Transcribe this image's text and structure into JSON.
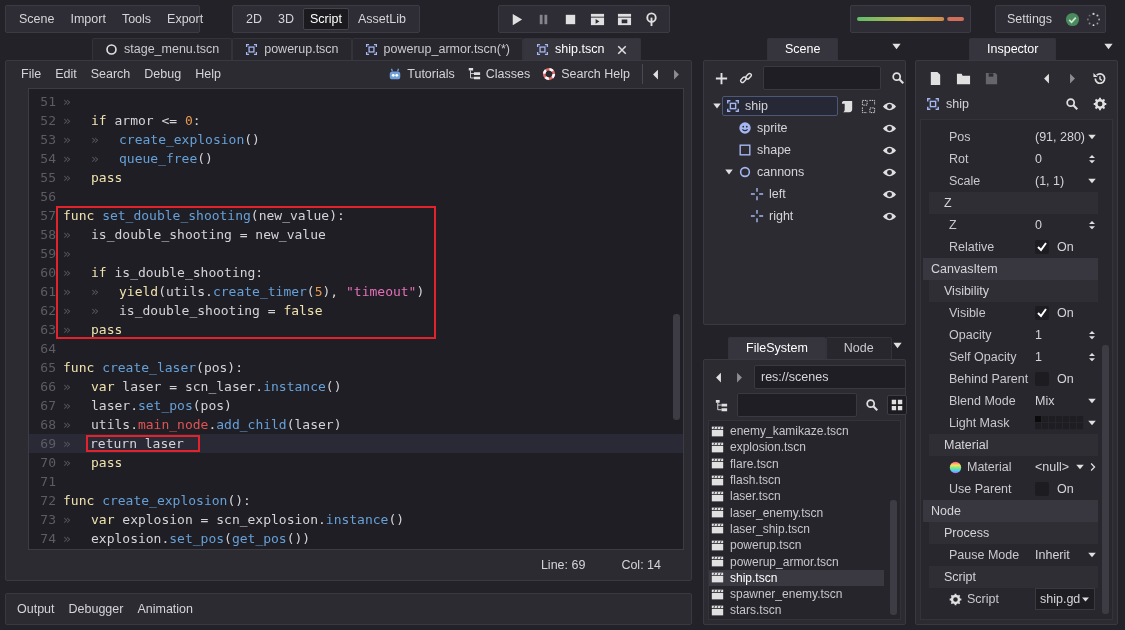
{
  "menus": [
    "Scene",
    "Import",
    "Tools",
    "Export"
  ],
  "workspaces": [
    {
      "label": "2D",
      "selected": false
    },
    {
      "label": "3D",
      "selected": false
    },
    {
      "label": "Script",
      "selected": true
    },
    {
      "label": "AssetLib",
      "selected": false
    }
  ],
  "settings": {
    "label": "Settings"
  },
  "scene_tabs": [
    {
      "label": "stage_menu.tscn",
      "kind": "node",
      "selected": false
    },
    {
      "label": "powerup.tscn",
      "kind": "node2d",
      "selected": false
    },
    {
      "label": "powerup_armor.tscn(*)",
      "kind": "node2d",
      "selected": false
    },
    {
      "label": "ship.tscn",
      "kind": "node2d",
      "selected": true
    }
  ],
  "script_menu": [
    "File",
    "Edit",
    "Search",
    "Debug",
    "Help"
  ],
  "help_buttons": [
    {
      "label": "Tutorials",
      "kind": "tutorials"
    },
    {
      "label": "Classes",
      "kind": "classes"
    },
    {
      "label": "Search Help",
      "kind": "search_help"
    }
  ],
  "code": {
    "lines": [
      {
        "number": "51",
        "boxed": false,
        "current": false,
        "tokens": [
          {
            "text": "»",
            "kind": "tab"
          }
        ]
      },
      {
        "number": "52",
        "boxed": false,
        "current": false,
        "tokens": [
          {
            "text": "»",
            "kind": "tab"
          },
          {
            "text": "if",
            "kind": "kw"
          },
          {
            "text": " armor <= ",
            "kind": "plain"
          },
          {
            "text": "0",
            "kind": "num"
          },
          {
            "text": ":",
            "kind": "plain"
          }
        ]
      },
      {
        "number": "53",
        "boxed": false,
        "current": false,
        "tokens": [
          {
            "text": "»",
            "kind": "tab"
          },
          {
            "text": "»",
            "kind": "tab"
          },
          {
            "text": "create_explosion",
            "kind": "fn"
          },
          {
            "text": "()",
            "kind": "plain"
          }
        ]
      },
      {
        "number": "54",
        "boxed": false,
        "current": false,
        "tokens": [
          {
            "text": "»",
            "kind": "tab"
          },
          {
            "text": "»",
            "kind": "tab"
          },
          {
            "text": "queue_free",
            "kind": "fn"
          },
          {
            "text": "()",
            "kind": "plain"
          }
        ]
      },
      {
        "number": "55",
        "boxed": false,
        "current": false,
        "tokens": [
          {
            "text": "»",
            "kind": "tab"
          },
          {
            "text": "pass",
            "kind": "kw"
          }
        ]
      },
      {
        "number": "56",
        "boxed": false,
        "current": false
      },
      {
        "number": "57",
        "boxed": true,
        "current": false,
        "tokens": [
          {
            "text": "func",
            "kind": "kw"
          },
          {
            "text": " set_double_shooting",
            "kind": "fn"
          },
          {
            "text": "(new_value):",
            "kind": "plain"
          }
        ]
      },
      {
        "number": "58",
        "boxed": true,
        "current": false,
        "tokens": [
          {
            "text": "»",
            "kind": "tab"
          },
          {
            "text": "is_double_shooting = new_value",
            "kind": "plain"
          }
        ]
      },
      {
        "number": "59",
        "boxed": true,
        "current": false,
        "tokens": [
          {
            "text": "»",
            "kind": "tab"
          }
        ]
      },
      {
        "number": "60",
        "boxed": true,
        "current": false,
        "tokens": [
          {
            "text": "»",
            "kind": "tab"
          },
          {
            "text": "if",
            "kind": "kw"
          },
          {
            "text": " is_double_shooting:",
            "kind": "plain"
          }
        ]
      },
      {
        "number": "61",
        "boxed": true,
        "current": false,
        "tokens": [
          {
            "text": "»",
            "kind": "tab"
          },
          {
            "text": "»",
            "kind": "tab"
          },
          {
            "text": "yield",
            "kind": "kw"
          },
          {
            "text": "(utils.",
            "kind": "plain"
          },
          {
            "text": "create_timer",
            "kind": "fn"
          },
          {
            "text": "(",
            "kind": "plain"
          },
          {
            "text": "5",
            "kind": "num"
          },
          {
            "text": "), ",
            "kind": "plain"
          },
          {
            "text": "\"timeout\"",
            "kind": "str"
          },
          {
            "text": ")",
            "kind": "plain"
          }
        ]
      },
      {
        "number": "62",
        "boxed": true,
        "current": false,
        "tokens": [
          {
            "text": "»",
            "kind": "tab"
          },
          {
            "text": "»",
            "kind": "tab"
          },
          {
            "text": "is_double_shooting = ",
            "kind": "plain"
          },
          {
            "text": "false",
            "kind": "kw"
          }
        ]
      },
      {
        "number": "63",
        "boxed": true,
        "current": false,
        "tokens": [
          {
            "text": "»",
            "kind": "tab"
          },
          {
            "text": "pass",
            "kind": "kw"
          }
        ]
      },
      {
        "number": "64",
        "boxed": false,
        "current": false
      },
      {
        "number": "65",
        "boxed": false,
        "current": false,
        "tokens": [
          {
            "text": "func",
            "kind": "kw"
          },
          {
            "text": " create_laser",
            "kind": "fn"
          },
          {
            "text": "(pos):",
            "kind": "plain"
          }
        ]
      },
      {
        "number": "66",
        "boxed": false,
        "current": false,
        "tokens": [
          {
            "text": "»",
            "kind": "tab"
          },
          {
            "text": "var",
            "kind": "kw"
          },
          {
            "text": " laser = scn_laser.",
            "kind": "plain"
          },
          {
            "text": "instance",
            "kind": "fn"
          },
          {
            "text": "()",
            "kind": "plain"
          }
        ]
      },
      {
        "number": "67",
        "boxed": false,
        "current": false,
        "tokens": [
          {
            "text": "»",
            "kind": "tab"
          },
          {
            "text": "laser.",
            "kind": "plain"
          },
          {
            "text": "set_pos",
            "kind": "fn"
          },
          {
            "text": "(pos)",
            "kind": "plain"
          }
        ]
      },
      {
        "number": "68",
        "boxed": false,
        "current": false,
        "tokens": [
          {
            "text": "»",
            "kind": "tab"
          },
          {
            "text": "utils.",
            "kind": "plain"
          },
          {
            "text": "main_node",
            "kind": "member"
          },
          {
            "text": ".",
            "kind": "plain"
          },
          {
            "text": "add_child",
            "kind": "fn"
          },
          {
            "text": "(laser)",
            "kind": "plain"
          }
        ]
      },
      {
        "number": "69",
        "boxed": false,
        "current": true,
        "tokens": [
          {
            "text": "»",
            "kind": "tab"
          },
          {
            "text": "return laser",
            "kind": "boxed"
          }
        ]
      },
      {
        "number": "70",
        "boxed": false,
        "current": false,
        "tokens": [
          {
            "text": "»",
            "kind": "tab"
          },
          {
            "text": "pass",
            "kind": "kw"
          }
        ]
      },
      {
        "number": "71",
        "boxed": false,
        "current": false
      },
      {
        "number": "72",
        "boxed": false,
        "current": false,
        "tokens": [
          {
            "text": "func",
            "kind": "kw"
          },
          {
            "text": " create_explosion",
            "kind": "fn"
          },
          {
            "text": "():",
            "kind": "plain"
          }
        ]
      },
      {
        "number": "73",
        "boxed": false,
        "current": false,
        "tokens": [
          {
            "text": "»",
            "kind": "tab"
          },
          {
            "text": "var",
            "kind": "kw"
          },
          {
            "text": " explosion = scn_explosion.",
            "kind": "plain"
          },
          {
            "text": "instance",
            "kind": "fn"
          },
          {
            "text": "()",
            "kind": "plain"
          }
        ]
      },
      {
        "number": "74",
        "boxed": false,
        "current": false,
        "tokens": [
          {
            "text": "»",
            "kind": "tab"
          },
          {
            "text": "explosion.",
            "kind": "plain"
          },
          {
            "text": "set_pos",
            "kind": "fn"
          },
          {
            "text": "(",
            "kind": "plain"
          },
          {
            "text": "get_pos",
            "kind": "fn"
          },
          {
            "text": "())",
            "kind": "plain"
          }
        ]
      }
    ]
  },
  "status": {
    "line": "Line: 69",
    "column": "Col: 14"
  },
  "bottom_tabs": [
    "Output",
    "Debugger",
    "Animation"
  ],
  "scene_dock": {
    "tab": "Scene",
    "tree": [
      {
        "name": "ship",
        "kind": "node2d",
        "selected": true,
        "expanded": true,
        "visible": true,
        "extras": [
          {
            "kind": "script"
          },
          {
            "kind": "group"
          }
        ],
        "children": [
          {
            "name": "sprite",
            "kind": "sprite",
            "selected": false,
            "visible": true
          },
          {
            "name": "shape",
            "kind": "shape",
            "selected": false,
            "visible": true
          },
          {
            "name": "cannons",
            "kind": "circle",
            "selected": false,
            "expanded": true,
            "visible": true,
            "children": [
              {
                "name": "left",
                "kind": "position",
                "selected": false,
                "visible": true
              },
              {
                "name": "right",
                "kind": "position",
                "selected": false,
                "visible": true
              }
            ]
          }
        ]
      }
    ]
  },
  "filesystem_dock": {
    "tabs": [
      {
        "label": "FileSystem",
        "selected": true
      },
      {
        "label": "Node",
        "selected": false
      }
    ],
    "path": "res://scenes",
    "files": [
      {
        "name": "enemy_kamikaze.tscn",
        "selected": false
      },
      {
        "name": "explosion.tscn",
        "selected": false
      },
      {
        "name": "flare.tscn",
        "selected": false
      },
      {
        "name": "flash.tscn",
        "selected": false
      },
      {
        "name": "laser.tscn",
        "selected": false
      },
      {
        "name": "laser_enemy.tscn",
        "selected": false
      },
      {
        "name": "laser_ship.tscn",
        "selected": false
      },
      {
        "name": "powerup.tscn",
        "selected": false
      },
      {
        "name": "powerup_armor.tscn",
        "selected": false
      },
      {
        "name": "ship.tscn",
        "selected": true
      },
      {
        "name": "spawner_enemy.tscn",
        "selected": false
      },
      {
        "name": "stars.tscn",
        "selected": false
      }
    ]
  },
  "inspector": {
    "tab": "Inspector",
    "node": "ship",
    "properties": [
      {
        "kind": "dropdown",
        "label": "Pos",
        "value": "(91, 280)"
      },
      {
        "kind": "spin",
        "label": "Rot",
        "value": "0"
      },
      {
        "kind": "dropdown",
        "label": "Scale",
        "value": "(1, 1)"
      },
      {
        "kind": "group",
        "label": "Z"
      },
      {
        "kind": "spin",
        "label": "Z",
        "value": "0"
      },
      {
        "kind": "check",
        "label": "Relative",
        "value": "On",
        "checked": true
      },
      {
        "kind": "section",
        "label": "CanvasItem"
      },
      {
        "kind": "group",
        "label": "Visibility"
      },
      {
        "kind": "check",
        "label": "Visible",
        "value": "On",
        "checked": true
      },
      {
        "kind": "spin",
        "label": "Opacity",
        "value": "1"
      },
      {
        "kind": "spin",
        "label": "Self Opacity",
        "value": "1"
      },
      {
        "kind": "check",
        "label": "Behind Parent",
        "value": "On",
        "checked": false
      },
      {
        "kind": "dropdown",
        "label": "Blend Mode",
        "value": "Mix"
      },
      {
        "kind": "layers",
        "label": "Light Mask"
      },
      {
        "kind": "group",
        "label": "Material"
      },
      {
        "kind": "material",
        "label": "Material",
        "value": "<null>"
      },
      {
        "kind": "check",
        "label": "Use Parent",
        "value": "On",
        "checked": false
      },
      {
        "kind": "section",
        "label": "Node"
      },
      {
        "kind": "group",
        "label": "Process"
      },
      {
        "kind": "dropdown",
        "label": "Pause Mode",
        "value": "Inherit"
      },
      {
        "kind": "group",
        "label": "Script"
      },
      {
        "kind": "script",
        "label": "Script",
        "value": "ship.gd"
      }
    ]
  }
}
